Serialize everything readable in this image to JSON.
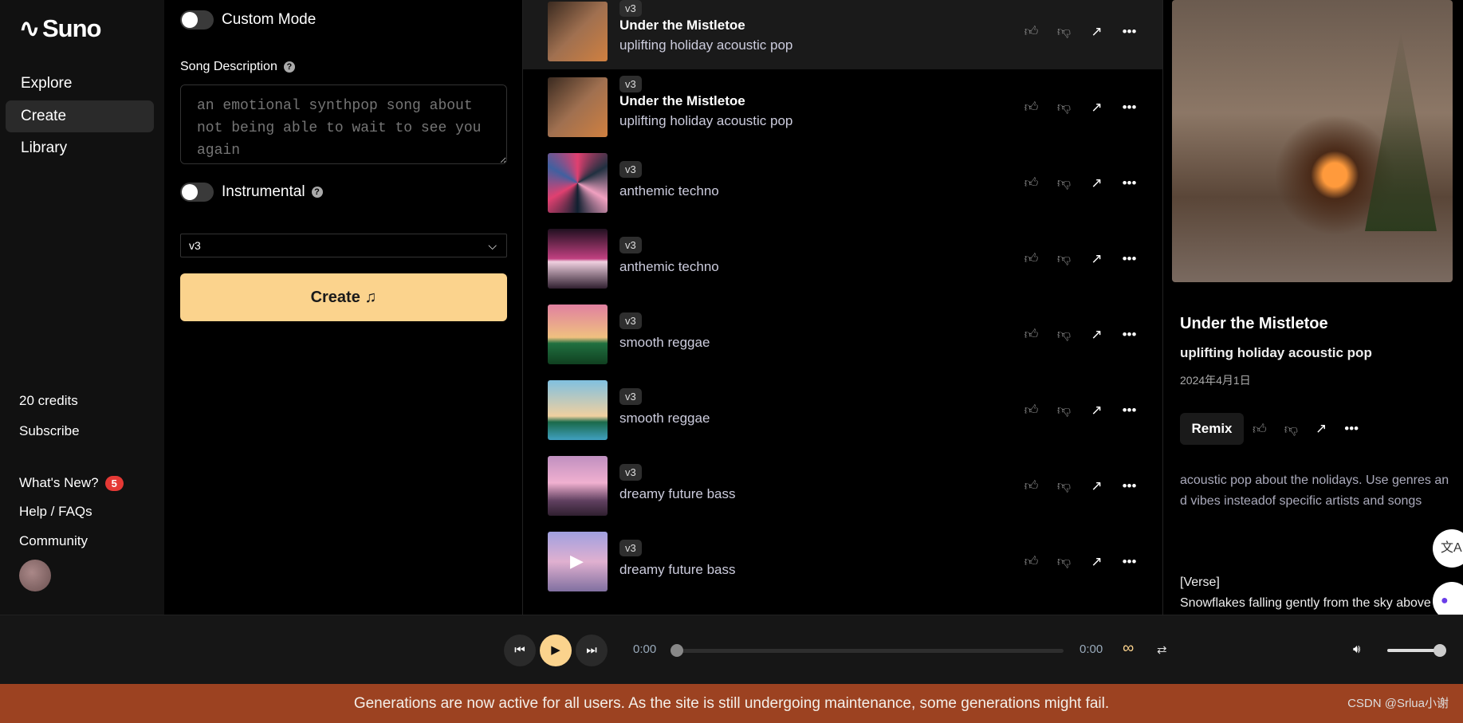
{
  "sidebar": {
    "brand": "Suno",
    "nav": [
      {
        "label": "Explore"
      },
      {
        "label": "Create",
        "active": true
      },
      {
        "label": "Library"
      }
    ],
    "credits": "20 credits",
    "subscribe": "Subscribe",
    "whats_new": "What's New?",
    "whats_new_count": "5",
    "help": "Help / FAQs",
    "community": "Community"
  },
  "form": {
    "custom_mode": "Custom Mode",
    "song_description_label": "Song Description",
    "song_description_placeholder": "an emotional synthpop song about not being able to wait to see you again",
    "instrumental": "Instrumental",
    "model": "v3",
    "create": "Create",
    "create_icon": "music-note-icon"
  },
  "songs": [
    {
      "version": "v3",
      "title": "Under the Mistletoe",
      "desc": "uplifting holiday acoustic pop",
      "selected": true
    },
    {
      "version": "v3",
      "title": "Under the Mistletoe",
      "desc": "uplifting holiday acoustic pop"
    },
    {
      "version": "v3",
      "title": "",
      "desc": "anthemic techno"
    },
    {
      "version": "v3",
      "title": "",
      "desc": "anthemic techno"
    },
    {
      "version": "v3",
      "title": "",
      "desc": "smooth reggae"
    },
    {
      "version": "v3",
      "title": "",
      "desc": "smooth reggae"
    },
    {
      "version": "v3",
      "title": "",
      "desc": "dreamy future bass"
    },
    {
      "version": "v3",
      "title": "",
      "desc": "dreamy future bass",
      "playing_overlay": true
    }
  ],
  "detail": {
    "title": "Under the Mistletoe",
    "style": "uplifting holiday acoustic pop",
    "date": "2024年4月1日",
    "remix": "Remix",
    "prompt": "acoustic pop about the nolidays. Use genres and vibes insteadof specific artists and songs",
    "lyrics_tag": "[Verse]",
    "lyrics_line": "Snowflakes falling gently from the sky above"
  },
  "player": {
    "current": "0:00",
    "duration": "0:00",
    "progress": 0,
    "volume": 1.0,
    "accent": "#fbd38d"
  },
  "banner": {
    "text": "Generations are now active for all users. As the site is still undergoing maintenance, some generations might fail.",
    "watermark": "CSDN @Srlua小谢",
    "color": "#9c4221"
  }
}
